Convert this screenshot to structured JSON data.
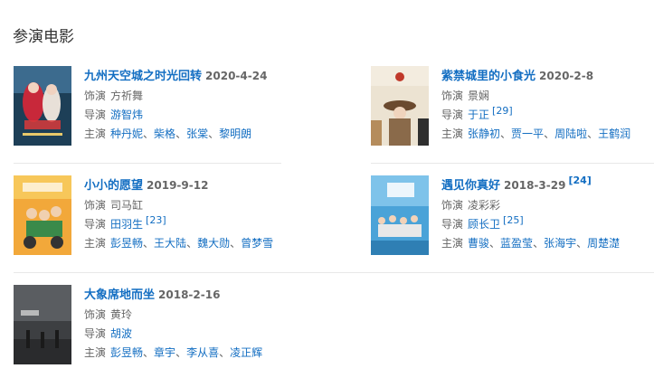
{
  "section_title": "参演电影",
  "colors": {
    "link": "#136ec2",
    "text": "#666666",
    "divider": "#e8e8e8"
  },
  "labels": {
    "role": "饰演",
    "director": "导演",
    "cast": "主演"
  },
  "movies": [
    {
      "title": "九州天空城之时光回转",
      "date": "2020-4-24",
      "ref": "",
      "role": "方祈舞",
      "director": "游智炜",
      "director_ref": "",
      "cast": [
        "种丹妮",
        "柴格",
        "张棠",
        "黎明朗"
      ],
      "poster_icon": "poster-fantasy-drama"
    },
    {
      "title": "紫禁城里的小食光",
      "date": "2020-2-8",
      "ref": "",
      "role": "景娴",
      "director": "于正",
      "director_ref": "[29]",
      "cast": [
        "张静初",
        "贾一平",
        "周陆啦",
        "王鹤润"
      ],
      "poster_icon": "poster-palace-drama"
    },
    {
      "title": "小小的愿望",
      "date": "2019-9-12",
      "ref": "",
      "role": "司马缸",
      "director": "田羽生",
      "director_ref": "[23]",
      "cast": [
        "彭昱畅",
        "王大陆",
        "魏大勋",
        "曾梦雪"
      ],
      "poster_icon": "poster-comedy"
    },
    {
      "title": "遇见你真好",
      "date": "2018-3-29",
      "ref": "[24]",
      "role": "凌彩彩",
      "director": "顾长卫",
      "director_ref": "[25]",
      "cast": [
        "曹骏",
        "蓝盈莹",
        "张海宇",
        "周楚濋"
      ],
      "poster_icon": "poster-youth-film"
    },
    {
      "title": "大象席地而坐",
      "date": "2018-2-16",
      "ref": "",
      "role": "黄玲",
      "director": "胡波",
      "director_ref": "",
      "cast": [
        "彭昱畅",
        "章宇",
        "李从喜",
        "凌正辉"
      ],
      "poster_icon": "poster-art-film"
    }
  ]
}
